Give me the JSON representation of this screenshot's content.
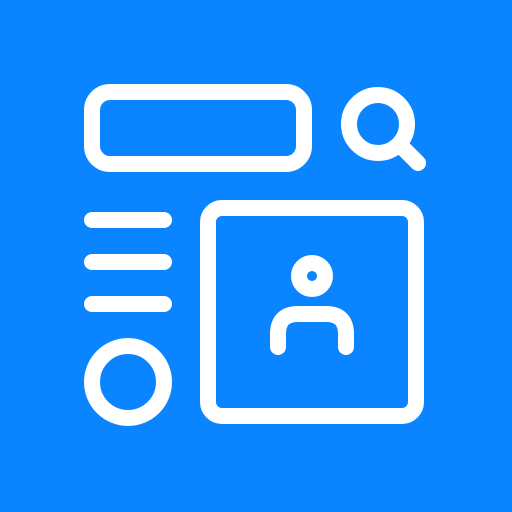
{
  "theme": {
    "background": "#0A84FF",
    "foreground": "#FFFFFF"
  },
  "icons": {
    "search": "search-icon",
    "menu": "menu-lines-icon",
    "user": "user-icon",
    "circle": "circle-button-icon"
  }
}
